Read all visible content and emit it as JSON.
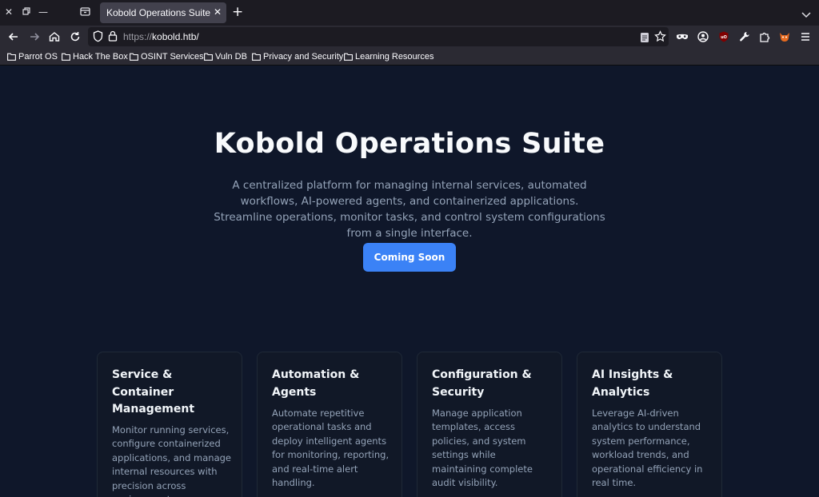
{
  "browser": {
    "tab_title": "Kobold Operations Suite",
    "url_scheme": "https://",
    "url_host": "kobold.htb/",
    "bookmarks": [
      "Parrot OS",
      "Hack The Box",
      "OSINT Services",
      "Vuln DB",
      "Privacy and Security",
      "Learning Resources"
    ]
  },
  "hero": {
    "title": "Kobold Operations Suite",
    "description": "A centralized platform for managing internal services, automated workflows, AI-powered agents, and containerized applications. Streamline operations, monitor tasks, and control system configurations from a single interface.",
    "cta_label": "Coming Soon"
  },
  "features": [
    {
      "title": "Service & Container Management",
      "body": "Monitor running services, configure containerized applications, and manage internal resources with precision across environments."
    },
    {
      "title": "Automation & Agents",
      "body": "Automate repetitive operational tasks and deploy intelligent agents for monitoring, reporting, and real-time alert handling."
    },
    {
      "title": "Configuration & Security",
      "body": "Manage application templates, access policies, and system settings while maintaining complete audit visibility."
    },
    {
      "title": "AI Insights & Analytics",
      "body": "Leverage AI-driven analytics to understand system performance, workload trends, and operational efficiency in real time."
    }
  ],
  "colors": {
    "page_bg": "#0f172a",
    "card_bg": "#111827",
    "accent": "#3b82f6",
    "muted_text": "#94a3b8"
  }
}
